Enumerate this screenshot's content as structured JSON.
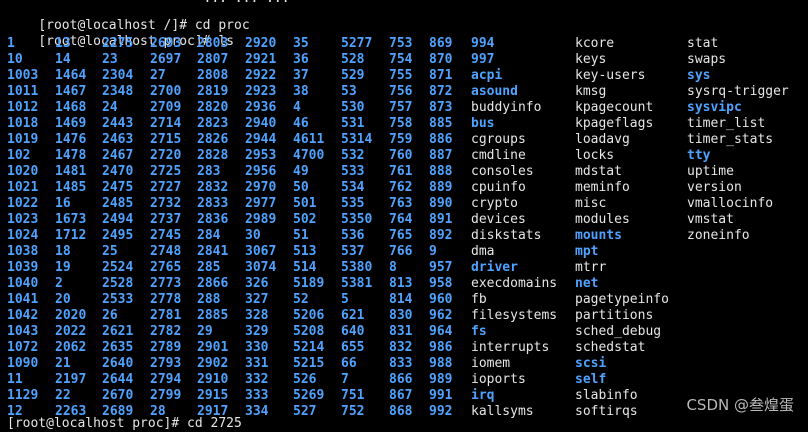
{
  "top_partial": "                          ... ... ...",
  "lines": [
    {
      "prompt": "[root@localhost /]# ",
      "command": "cd proc"
    },
    {
      "prompt": "[root@localhost proc]# ",
      "command": "ls"
    }
  ],
  "bottom_partial": "[root@localhost proc]# cd 2725",
  "watermark": "CSDN @叁煌蛋",
  "ls_columns": [
    [
      "1",
      "10",
      "1003",
      "1011",
      "1012",
      "1018",
      "1019",
      "102",
      "1020",
      "1021",
      "1022",
      "1023",
      "1024",
      "1038",
      "1039",
      "1040",
      "1041",
      "1042",
      "1043",
      "1072",
      "1090",
      "11",
      "1129",
      "12"
    ],
    [
      "13",
      "14",
      "1464",
      "1467",
      "1468",
      "1469",
      "1476",
      "1478",
      "1481",
      "1485",
      "16",
      "1673",
      "1712",
      "18",
      "19",
      "2",
      "20",
      "2020",
      "2022",
      "2062",
      "21",
      "2197",
      "22",
      "2263"
    ],
    [
      "2275",
      "23",
      "2304",
      "2348",
      "24",
      "2443",
      "2463",
      "2467",
      "2470",
      "2475",
      "2485",
      "2494",
      "2495",
      "25",
      "2524",
      "2528",
      "2533",
      "26",
      "2621",
      "2635",
      "2640",
      "2644",
      "2670",
      "2689"
    ],
    [
      "2693",
      "2697",
      "27",
      "2700",
      "2709",
      "2714",
      "2715",
      "2720",
      "2725",
      "2727",
      "2732",
      "2737",
      "2745",
      "2748",
      "2765",
      "2773",
      "2778",
      "2781",
      "2782",
      "2789",
      "2793",
      "2794",
      "2799",
      "28"
    ],
    [
      "2803",
      "2807",
      "2808",
      "2819",
      "2820",
      "2823",
      "2826",
      "2828",
      "283",
      "2832",
      "2833",
      "2836",
      "284",
      "2841",
      "285",
      "2866",
      "288",
      "2885",
      "29",
      "2901",
      "2902",
      "2910",
      "2915",
      "2917"
    ],
    [
      "2920",
      "2921",
      "2922",
      "2923",
      "2936",
      "2940",
      "2944",
      "2953",
      "2956",
      "2970",
      "2977",
      "2989",
      "30",
      "3067",
      "3074",
      "326",
      "327",
      "328",
      "329",
      "330",
      "331",
      "332",
      "333",
      "334"
    ],
    [
      "35",
      "36",
      "37",
      "38",
      "4",
      "46",
      "4611",
      "4700",
      "49",
      "50",
      "501",
      "502",
      "51",
      "513",
      "514",
      "5189",
      "52",
      "5206",
      "5208",
      "5214",
      "5215",
      "526",
      "5269",
      "527"
    ],
    [
      "5277",
      "528",
      "529",
      "53",
      "530",
      "531",
      "5314",
      "532",
      "533",
      "534",
      "535",
      "5350",
      "536",
      "537",
      "5380",
      "5381",
      "5",
      "621",
      "640",
      "655",
      "66",
      "7",
      "751",
      "752"
    ],
    [
      "753",
      "754",
      "755",
      "756",
      "757",
      "758",
      "759",
      "760",
      "761",
      "762",
      "763",
      "764",
      "765",
      "766",
      "8",
      "813",
      "814",
      "830",
      "831",
      "832",
      "833",
      "866",
      "867",
      "868"
    ],
    [
      "869",
      "870",
      "871",
      "872",
      "873",
      "885",
      "886",
      "887",
      "888",
      "889",
      "890",
      "891",
      "892",
      "9",
      "957",
      "958",
      "960",
      "962",
      "964",
      "986",
      "988",
      "989",
      "991",
      "992"
    ],
    [
      "994",
      "997",
      "acpi",
      "asound",
      "buddyinfo",
      "bus",
      "cgroups",
      "cmdline",
      "consoles",
      "cpuinfo",
      "crypto",
      "devices",
      "diskstats",
      "dma",
      "driver",
      "execdomains",
      "fb",
      "filesystems",
      "fs",
      "interrupts",
      "iomem",
      "ioports",
      "irq",
      "kallsyms"
    ],
    [
      "kcore",
      "keys",
      "key-users",
      "kmsg",
      "kpagecount",
      "kpageflags",
      "loadavg",
      "locks",
      "mdstat",
      "meminfo",
      "misc",
      "modules",
      "mounts",
      "mpt",
      "mtrr",
      "net",
      "pagetypeinfo",
      "partitions",
      "sched_debug",
      "schedstat",
      "scsi",
      "self",
      "slabinfo",
      "softirqs"
    ],
    [
      "stat",
      "swaps",
      "sys",
      "sysrq-trigger",
      "sysvipc",
      "timer_list",
      "timer_stats",
      "tty",
      "uptime",
      "version",
      "vmallocinfo",
      "vmstat",
      "zoneinfo"
    ]
  ],
  "dir_names": [
    "1",
    "10",
    "1003",
    "1011",
    "1012",
    "1018",
    "1019",
    "102",
    "1020",
    "1021",
    "1022",
    "1023",
    "1024",
    "1038",
    "1039",
    "1040",
    "1041",
    "1042",
    "1043",
    "1072",
    "1090",
    "11",
    "1129",
    "12",
    "13",
    "14",
    "1464",
    "1467",
    "1468",
    "1469",
    "1476",
    "1478",
    "1481",
    "1485",
    "16",
    "1673",
    "1712",
    "18",
    "19",
    "2",
    "20",
    "2020",
    "2022",
    "2062",
    "21",
    "2197",
    "22",
    "2263",
    "2275",
    "23",
    "2304",
    "2348",
    "24",
    "2443",
    "2463",
    "2467",
    "2470",
    "2475",
    "2485",
    "2494",
    "2495",
    "25",
    "2524",
    "2528",
    "2533",
    "26",
    "2621",
    "2635",
    "2640",
    "2644",
    "2670",
    "2689",
    "2693",
    "2697",
    "27",
    "2700",
    "2709",
    "2714",
    "2715",
    "2720",
    "2725",
    "2727",
    "2732",
    "2737",
    "2745",
    "2748",
    "2765",
    "2773",
    "2778",
    "2781",
    "2782",
    "2789",
    "2793",
    "2794",
    "2799",
    "28",
    "2803",
    "2807",
    "2808",
    "2819",
    "2820",
    "2823",
    "2826",
    "2828",
    "283",
    "2832",
    "2833",
    "2836",
    "284",
    "2841",
    "285",
    "2866",
    "288",
    "2885",
    "29",
    "2901",
    "2902",
    "2910",
    "2915",
    "2917",
    "2920",
    "2921",
    "2922",
    "2923",
    "2936",
    "2940",
    "2944",
    "2953",
    "2956",
    "2970",
    "2977",
    "2989",
    "30",
    "3067",
    "3074",
    "326",
    "327",
    "328",
    "329",
    "330",
    "331",
    "332",
    "333",
    "334",
    "35",
    "36",
    "37",
    "38",
    "4",
    "46",
    "4611",
    "4700",
    "49",
    "50",
    "501",
    "502",
    "51",
    "513",
    "514",
    "5189",
    "52",
    "5206",
    "5208",
    "5214",
    "5215",
    "526",
    "5269",
    "527",
    "5277",
    "528",
    "529",
    "53",
    "530",
    "531",
    "5314",
    "532",
    "533",
    "534",
    "535",
    "5350",
    "536",
    "537",
    "5380",
    "5381",
    "5",
    "621",
    "640",
    "655",
    "66",
    "7",
    "751",
    "752",
    "753",
    "754",
    "755",
    "756",
    "757",
    "758",
    "759",
    "760",
    "761",
    "762",
    "763",
    "764",
    "765",
    "766",
    "8",
    "813",
    "814",
    "830",
    "831",
    "832",
    "833",
    "866",
    "867",
    "868",
    "869",
    "870",
    "871",
    "872",
    "873",
    "885",
    "886",
    "887",
    "888",
    "889",
    "890",
    "891",
    "892",
    "9",
    "957",
    "958",
    "960",
    "962",
    "964",
    "986",
    "988",
    "989",
    "991",
    "992",
    "994",
    "997",
    "acpi",
    "asound",
    "bus",
    "driver",
    "fs",
    "irq",
    "mounts",
    "mpt",
    "net",
    "scsi",
    "self",
    "sys",
    "sysvipc",
    "tty"
  ],
  "colors": {
    "background": "#000000",
    "text": "#e6e6e6",
    "dir": "#4fa3ff"
  }
}
